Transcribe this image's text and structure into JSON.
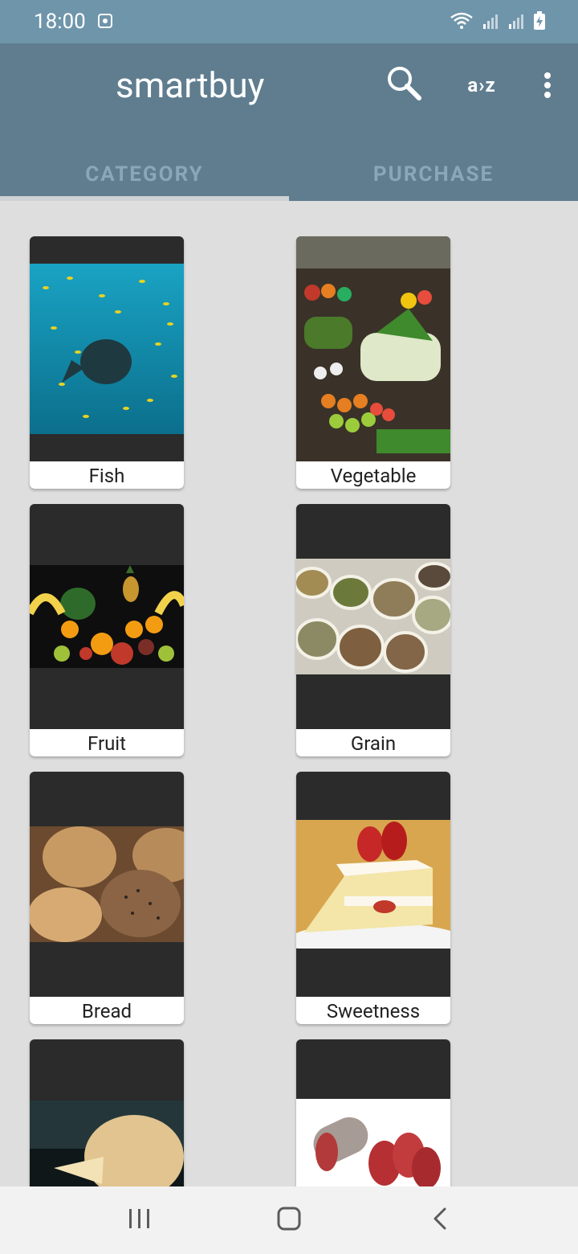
{
  "status_bar": {
    "time": "18:00"
  },
  "app": {
    "title": "smartbuy",
    "actions": {
      "sort_label": "a›z"
    },
    "tabs": [
      {
        "label": "CATEGORY"
      },
      {
        "label": "PURCHASE"
      }
    ]
  },
  "categories": [
    {
      "label": "Fish"
    },
    {
      "label": "Vegetable"
    },
    {
      "label": "Fruit"
    },
    {
      "label": "Grain"
    },
    {
      "label": "Bread"
    },
    {
      "label": "Sweetness"
    },
    {
      "label": ""
    },
    {
      "label": ""
    }
  ],
  "colors": {
    "status_bar": "#6f95aa",
    "app_bar": "#5f7d8f",
    "tab_text": "#8aa7b9",
    "background": "#dedede",
    "card_bg": "#2b2b2b"
  }
}
